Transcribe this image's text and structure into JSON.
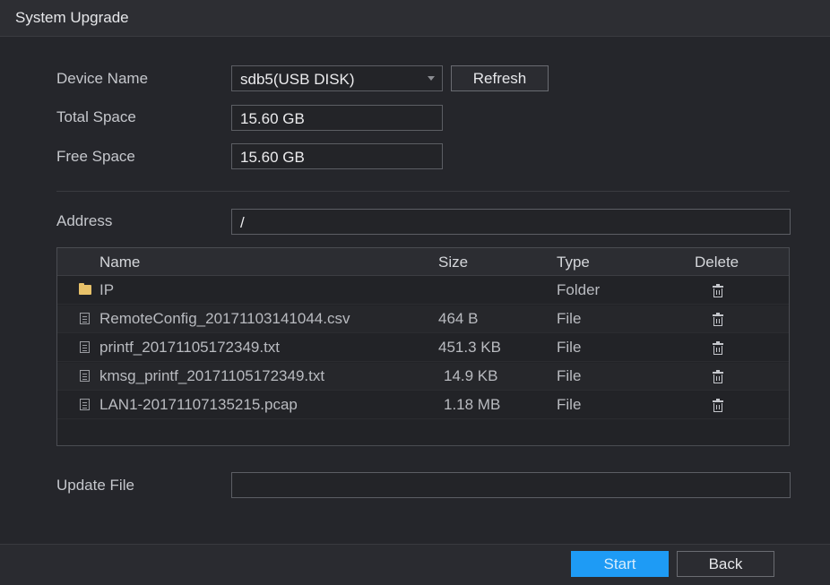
{
  "window": {
    "title": "System Upgrade"
  },
  "device": {
    "name_label": "Device Name",
    "name_value": "sdb5(USB DISK)",
    "refresh_label": "Refresh",
    "total_label": "Total Space",
    "total_value": "15.60 GB",
    "free_label": "Free Space",
    "free_value": "15.60 GB"
  },
  "address": {
    "label": "Address",
    "value": "/"
  },
  "table": {
    "headers": {
      "name": "Name",
      "size": "Size",
      "type": "Type",
      "delete": "Delete"
    },
    "rows": [
      {
        "name": "IP",
        "size": "",
        "type": "Folder",
        "icon": "folder-icon"
      },
      {
        "name": "RemoteConfig_20171103141044.csv",
        "size": "464 B",
        "type": "File",
        "icon": "file-icon"
      },
      {
        "name": "printf_20171105172349.txt",
        "size": "451.3 KB",
        "type": "File",
        "icon": "file-icon"
      },
      {
        "name": "kmsg_printf_20171105172349.txt",
        "size": "14.9 KB",
        "type": "File",
        "icon": "file-icon"
      },
      {
        "name": "LAN1-20171107135215.pcap",
        "size": "1.18 MB",
        "type": "File",
        "icon": "file-icon"
      }
    ]
  },
  "update": {
    "label": "Update File",
    "value": ""
  },
  "footer": {
    "start_label": "Start",
    "back_label": "Back"
  },
  "colors": {
    "accent": "#1e9bf5",
    "background": "#25262b",
    "folder": "#e8c26a"
  }
}
